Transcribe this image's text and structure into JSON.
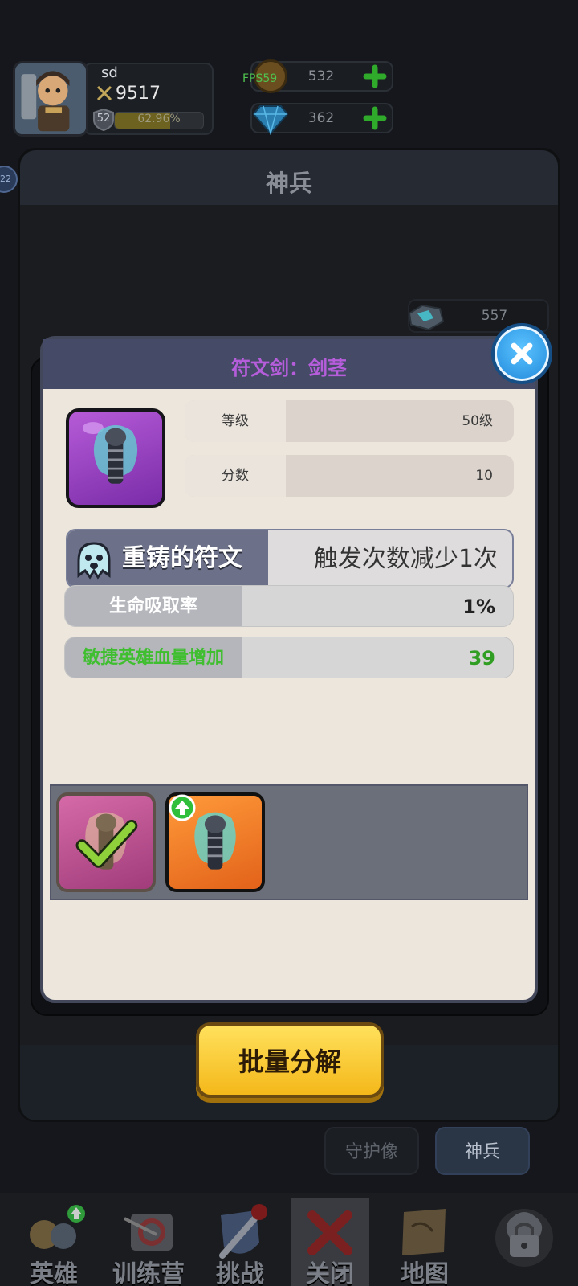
{
  "hud": {
    "player_name": "sd",
    "power": "9517",
    "level": "52",
    "exp_text": "62.96%",
    "exp_fraction": 0.6296,
    "gold": "532",
    "gems": "362",
    "fps": "FPS59",
    "side_badge": "22"
  },
  "main": {
    "title": "神兵",
    "stone_count": "557",
    "tabs": [
      "守护像",
      "神兵"
    ],
    "batch_button": "批量分解"
  },
  "dialog": {
    "title": "符文剑：剑茎",
    "stats": [
      {
        "label": "等级",
        "value": "50级"
      },
      {
        "label": "分数",
        "value": "10"
      }
    ],
    "rune": {
      "name": "重铸的符文",
      "effect": "触发次数减少1次"
    },
    "bars": [
      {
        "label": "生命吸取率",
        "value": "1%",
        "label_color": "#ffffff",
        "value_color": "#222222"
      },
      {
        "label": "敏捷英雄血量增加",
        "value": "39",
        "label_color": "#3fbf2f",
        "value_color": "#2f9e22"
      }
    ]
  },
  "nav": [
    "英雄",
    "训练营",
    "挑战",
    "关闭",
    "地图"
  ],
  "colors": {
    "dialog_title": "#b55ddb",
    "accent_green": "#3fbf2f",
    "button_yellow": "#f4b81a"
  }
}
